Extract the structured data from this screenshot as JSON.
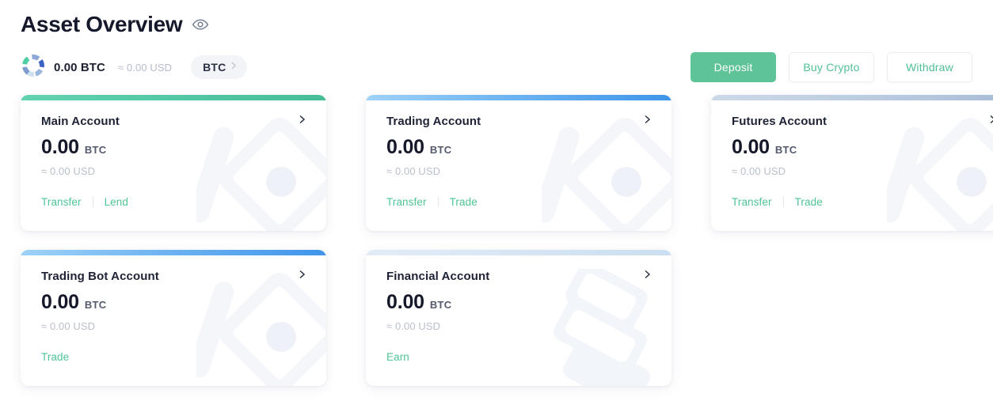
{
  "header": {
    "title": "Asset Overview",
    "eye_icon": "eye-icon"
  },
  "summary": {
    "portfolio_icon": "donut-chart-icon",
    "amount": "0.00 BTC",
    "approx": "≈ 0.00 USD",
    "coin_chip": {
      "label": "BTC",
      "chevron_icon": "chevron-right-icon"
    },
    "actions": {
      "deposit": "Deposit",
      "buy_crypto": "Buy Crypto",
      "withdraw": "Withdraw"
    }
  },
  "colors": {
    "primary_green": "#5ec396",
    "link_green": "#4ec596",
    "accent_blue": "#6fb5f2",
    "accent_grey": "#bacbe0",
    "title_navy": "#15192b",
    "muted_grey": "#b9bfca",
    "chip_bg": "#f2f4f7"
  },
  "accounts": [
    {
      "name": "Main Account",
      "balance": "0.00",
      "unit": "BTC",
      "usd": "≈ 0.00 USD",
      "accent": "green",
      "watermark": "gem-diamond-watermark",
      "arrow_icon": "chevron-right-icon",
      "links": [
        "Transfer",
        "Lend"
      ]
    },
    {
      "name": "Trading Account",
      "balance": "0.00",
      "unit": "BTC",
      "usd": "≈ 0.00 USD",
      "accent": "blue",
      "watermark": "gem-diamond-watermark",
      "arrow_icon": "chevron-right-icon",
      "links": [
        "Transfer",
        "Trade"
      ]
    },
    {
      "name": "Futures Account",
      "balance": "0.00",
      "unit": "BTC",
      "usd": "≈ 0.00 USD",
      "accent": "grey",
      "watermark": "gem-diamond-watermark",
      "arrow_icon": "chevron-right-icon",
      "links": [
        "Transfer",
        "Trade"
      ]
    },
    {
      "name": "Trading Bot Account",
      "balance": "0.00",
      "unit": "BTC",
      "usd": "≈ 0.00 USD",
      "accent": "blue",
      "watermark": "gem-diamond-watermark",
      "arrow_icon": "chevron-right-icon",
      "links": [
        "Trade"
      ]
    },
    {
      "name": "Financial Account",
      "balance": "0.00",
      "unit": "BTC",
      "usd": "≈ 0.00 USD",
      "accent": "pale",
      "watermark": "stacked-blocks-watermark",
      "arrow_icon": "chevron-right-icon",
      "links": [
        "Earn"
      ]
    }
  ]
}
